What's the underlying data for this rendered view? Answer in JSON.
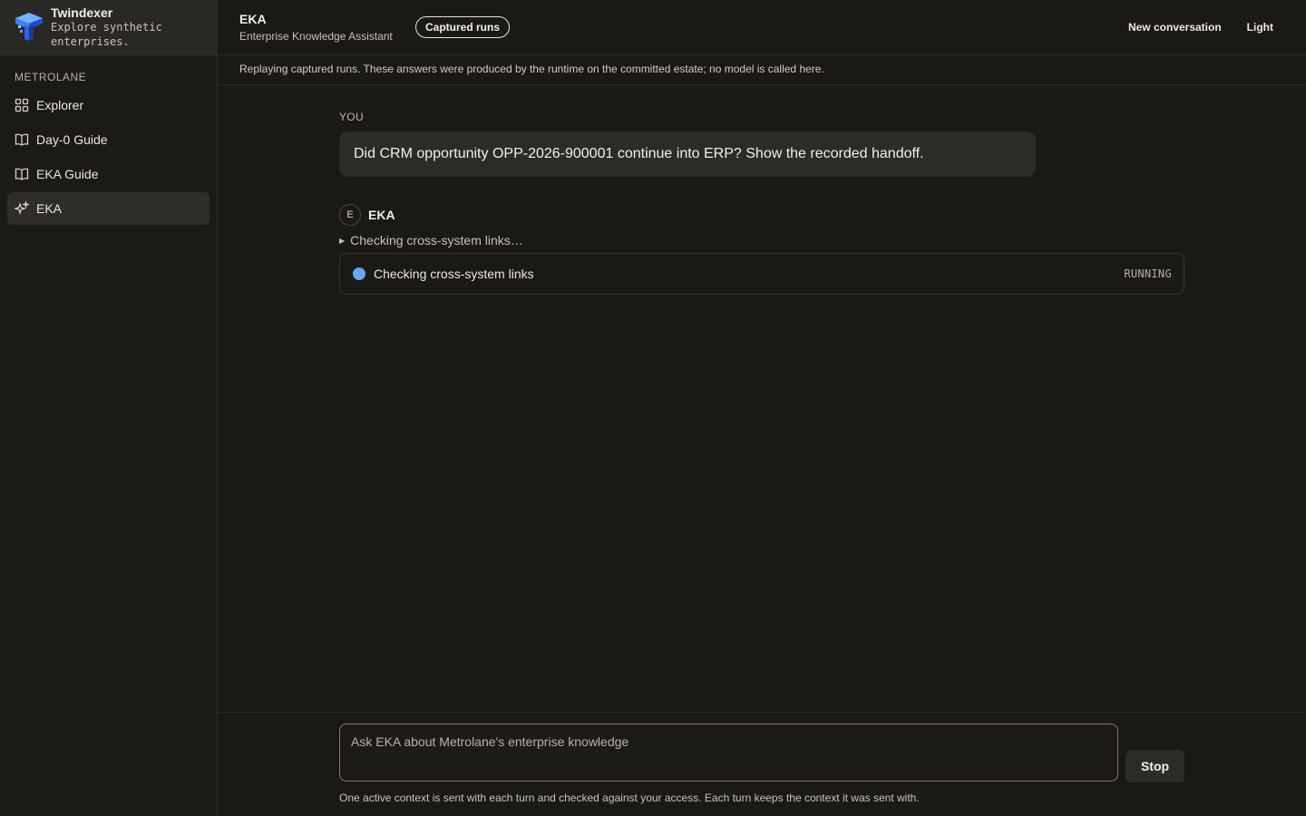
{
  "brand": {
    "name": "Twindexer",
    "tagline": "Explore synthetic enterprises.",
    "logo_color": "#3b82f6"
  },
  "sidebar": {
    "workspace": "METROLANE",
    "items": [
      {
        "label": "Explorer",
        "icon": "grid-icon"
      },
      {
        "label": "Day-0 Guide",
        "icon": "book-icon"
      },
      {
        "label": "EKA Guide",
        "icon": "book-icon"
      },
      {
        "label": "EKA",
        "icon": "sparkle-icon",
        "active": true
      }
    ]
  },
  "header": {
    "title": "EKA",
    "subtitle": "Enterprise Knowledge Assistant",
    "badge": "Captured runs",
    "new_conversation": "New conversation",
    "theme_toggle": "Light"
  },
  "banner": "Replaying captured runs. These answers were produced by the runtime on the committed estate; no model is called here.",
  "conversation": {
    "user_label": "YOU",
    "user_message": "Did CRM opportunity OPP-2026-900001 continue into ERP? Show the recorded handoff.",
    "assistant_avatar": "E",
    "assistant_name": "EKA",
    "trace_summary": "Checking cross-system links…",
    "step": {
      "text": "Checking cross-system links",
      "status": "RUNNING",
      "status_color": "#6ba6ee"
    }
  },
  "composer": {
    "placeholder": "Ask EKA about Metrolane's enterprise knowledge",
    "value": "",
    "stop_label": "Stop",
    "note": "One active context is sent with each turn and checked against your access. Each turn keeps the context it was sent with.",
    "border_color": "#8a7a5c"
  }
}
